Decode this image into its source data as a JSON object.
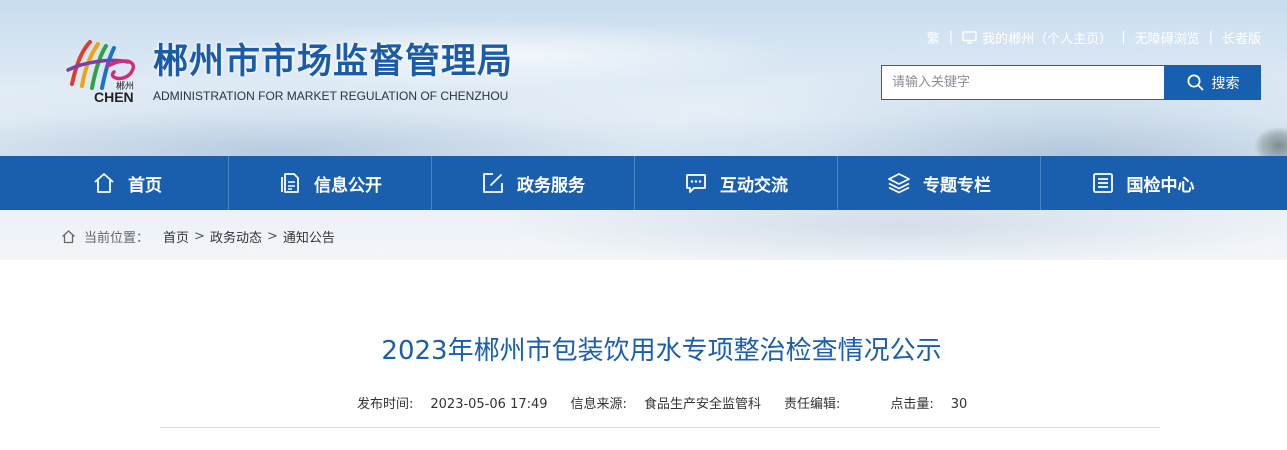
{
  "header": {
    "logo_text": "郴州",
    "logo_word": "CHEN",
    "title": "郴州市市场监督管理局",
    "subtitle": "ADMINISTRATION FOR MARKET REGULATION OF CHENZHOU",
    "top_links": {
      "traditional": "繁",
      "my_chenzhou": "我的郴州（个人主页）",
      "accessible": "无障碍浏览",
      "elder": "长者版"
    },
    "separator": "|",
    "search": {
      "placeholder": "请输入关键字",
      "button_label": "搜索"
    }
  },
  "nav": {
    "items": [
      {
        "label": "首页",
        "icon": "home-icon"
      },
      {
        "label": "信息公开",
        "icon": "document-icon"
      },
      {
        "label": "政务服务",
        "icon": "edit-icon"
      },
      {
        "label": "互动交流",
        "icon": "chat-icon"
      },
      {
        "label": "专题专栏",
        "icon": "layers-icon"
      },
      {
        "label": "国检中心",
        "icon": "list-icon"
      }
    ]
  },
  "breadcrumb": {
    "label": "当前位置：",
    "items": [
      "首页",
      "政务动态",
      "通知公告"
    ],
    "separator": ">"
  },
  "article": {
    "title": "2023年郴州市包装饮用水专项整治检查情况公示",
    "meta": {
      "publish_label": "发布时间:",
      "publish_value": "2023-05-06 17:49",
      "source_label": "信息来源:",
      "source_value": "食品生产安全监管科",
      "editor_label": "责任编辑:",
      "editor_value": "",
      "hits_label": "点击量:",
      "hits_value": "30"
    }
  },
  "colors": {
    "brand_blue": "#1a5fae",
    "title_blue": "#1a5ca8",
    "text_dark": "#333333"
  }
}
